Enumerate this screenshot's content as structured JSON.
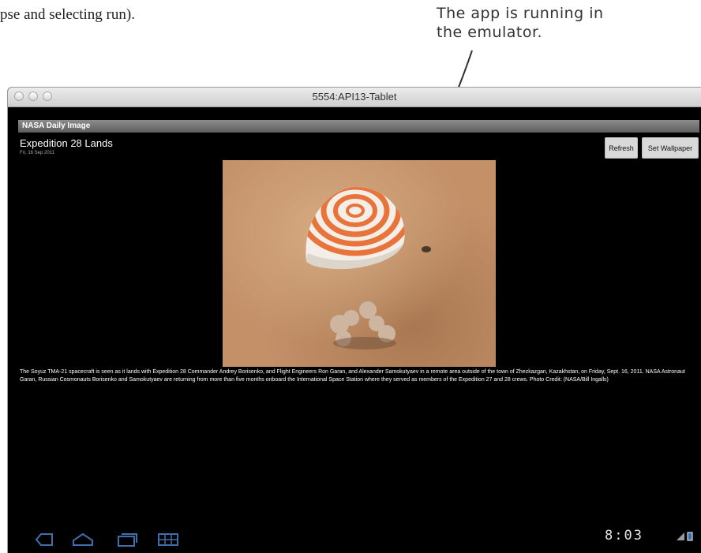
{
  "book": {
    "text": "pse and selecting run)."
  },
  "annotation": {
    "text": "The app is running in\nthe emulator."
  },
  "window": {
    "title": "5554:API13-Tablet"
  },
  "app": {
    "title": "NASA Daily Image",
    "headline": "Expedition 28 Lands",
    "date": "Fri, 16 Sep 2011",
    "refresh_label": "Refresh",
    "wallpaper_label": "Set Wallpaper",
    "caption": "The Soyuz TMA-21 spacecraft is seen as it lands with Expedition 28 Commander Andrey Borisenko, and Flight Engineers Ron Garan, and Alexander Samokutyaev in a remote area outside of the town of Zhezkazgan, Kazakhstan, on Friday, Sept. 16, 2011. NASA Astronaut Garan, Russian Cosmonauts Borisenko and Samokutyaev are returning from more than five months onboard the International Space Station where they served as members of the Expedition 27 and 28 crews. Photo Credit: (NASA/Bill Ingalls)"
  },
  "navbar": {
    "icons": [
      "back-icon",
      "home-icon",
      "recent-apps-icon",
      "menu-icon"
    ],
    "clock": "8:03"
  },
  "colors": {
    "title_bar": "#6e6e6e",
    "parachute_orange": "#e8743b",
    "navbar_icon": "#3f6fa8"
  }
}
